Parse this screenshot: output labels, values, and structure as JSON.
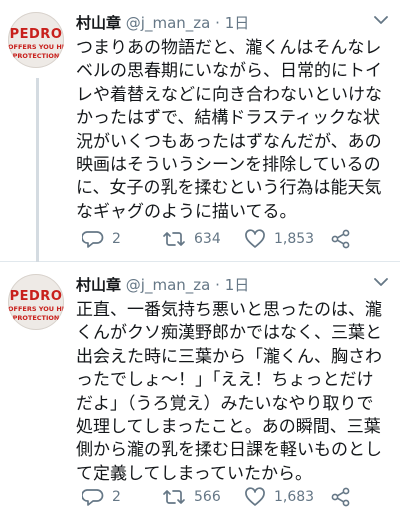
{
  "tweets": [
    {
      "name": "村山章",
      "handle": "@j_man_za",
      "dot": "·",
      "time": "1日",
      "avatar_text": [
        "PEDRO",
        "OFFERS YOU HI",
        "PROTECTION"
      ],
      "lines": [
        "つまりあの物語だと、瀧くんはそんなレ",
        "ベルの思春期にいながら、日常的にトイ",
        "レや着替えなどに向き合わないといけな",
        "かったはずで、結構ドラスティックな状",
        "況がいくつもあったはずなんだが、あの",
        "映画はそういうシーンを排除しているの",
        "に、女子の乳を揉むという行為は能天気",
        "なギャグのように描いてる。"
      ],
      "replies": "2",
      "retweets": "634",
      "likes": "1,853"
    },
    {
      "name": "村山章",
      "handle": "@j_man_za",
      "dot": "·",
      "time": "1日",
      "avatar_text": [
        "PEDRO",
        "OFFERS YOU HI",
        "PROTECTION"
      ],
      "lines": [
        "正直、一番気持ち悪いと思ったのは、瀧",
        "くんがクソ痴漢野郎かではなく、三葉と",
        "出会えた時に三葉から「瀧くん、胸さわ",
        "ったでしょ〜！」「ええ！ちょっとだけ",
        "だよ」（うろ覚え）みたいなやり取りで",
        "処理してしまったこと。あの瞬間、三葉",
        "側から瀧の乳を揉む日課を軽いものとし",
        "て定義してしまっていたから。"
      ],
      "replies": "2",
      "retweets": "566",
      "likes": "1,683"
    }
  ],
  "colors": {
    "text": "#14171a",
    "muted": "#657786",
    "avatar_text": "#c8201c",
    "divider": "#e1e8ed"
  },
  "icons": [
    "chevron-down-icon",
    "reply-icon",
    "retweet-icon",
    "like-icon",
    "share-icon"
  ]
}
